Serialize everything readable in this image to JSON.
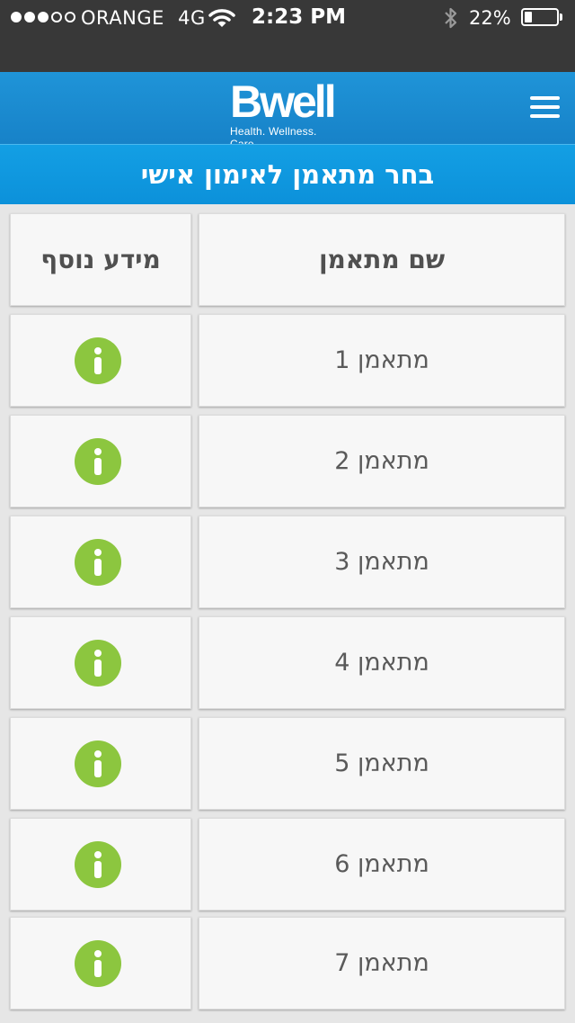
{
  "status_bar": {
    "carrier": "ORANGE",
    "network": "4G",
    "time": "2:23 PM",
    "battery_text": "22%",
    "battery_level": 0.22,
    "signal_bars": 3,
    "signal_total": 5
  },
  "header": {
    "logo_text": "Bwell",
    "logo_tagline": "Health. Wellness. Care.",
    "brand_color": "#1f94d8"
  },
  "title_bar": {
    "title": "בחר מתאמן לאימון אישי"
  },
  "table": {
    "columns": {
      "name": "שם מתאמן",
      "info": "מידע נוסף"
    },
    "rows": [
      {
        "name": "מתאמן 1"
      },
      {
        "name": "מתאמן 2"
      },
      {
        "name": "מתאמן 3"
      },
      {
        "name": "מתאמן 4"
      },
      {
        "name": "מתאמן 5"
      },
      {
        "name": "מתאמן 6"
      },
      {
        "name": "מתאמן 7"
      }
    ],
    "info_icon_color": "#8cc63f"
  }
}
